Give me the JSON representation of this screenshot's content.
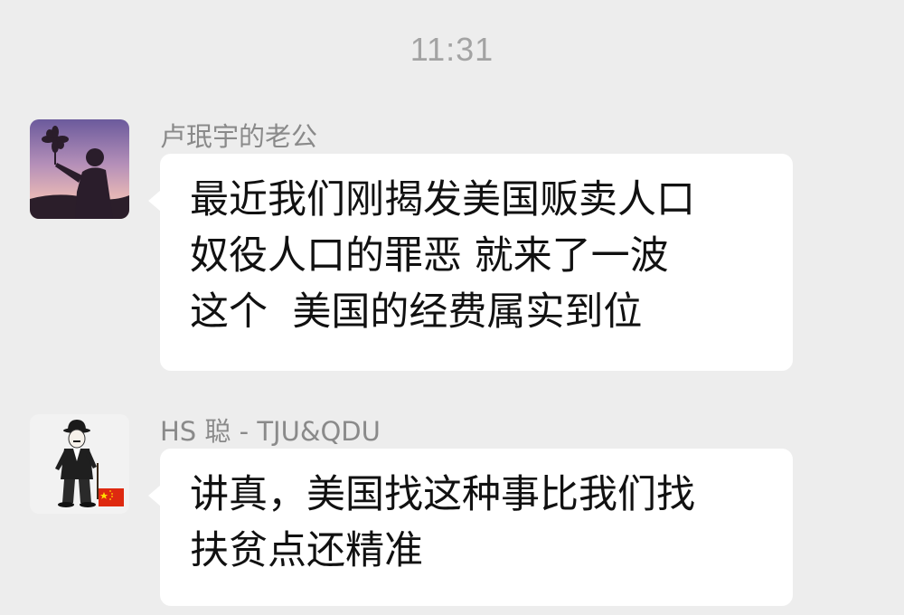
{
  "timestamp": "11:31",
  "messages": [
    {
      "sender": "卢珉宇的老公",
      "text": "最近我们刚揭发美国贩卖人口\n奴役人口的罪恶 就来了一波\n这个  美国的经费属实到位",
      "avatar": "silhouette-with-pinwheel"
    },
    {
      "sender": "HS 聪 - TJU&QDU",
      "text": "讲真，美国找这种事比我们找\n扶贫点还精准",
      "avatar": "chaplin-figure-with-flag"
    }
  ],
  "colors": {
    "background": "#ededed",
    "bubble": "#ffffff",
    "timestamp": "#a3a3a3",
    "sender_name": "#8a8a8a",
    "message_text": "#111111"
  }
}
